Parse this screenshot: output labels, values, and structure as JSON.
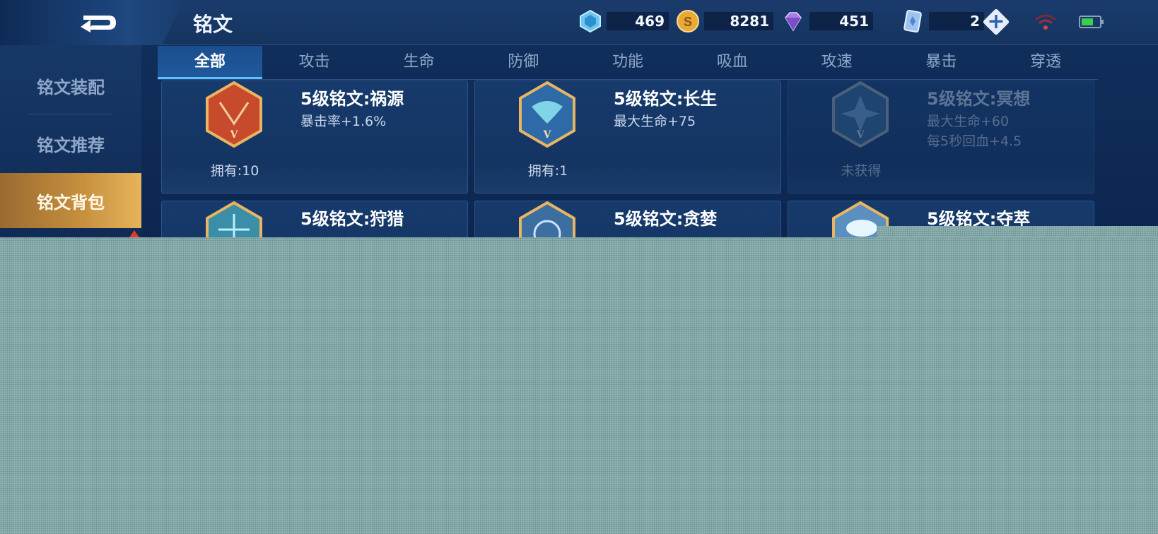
{
  "header": {
    "title": "铭文",
    "resources": [
      {
        "icon": "blue-crystal-icon",
        "value": "469"
      },
      {
        "icon": "gold-coin-icon",
        "value": "8281"
      },
      {
        "icon": "purple-diamond-icon",
        "value": "451"
      },
      {
        "icon": "card-ticket-icon",
        "value": "2"
      }
    ]
  },
  "sidebar": {
    "items": [
      {
        "label": "铭文装配"
      },
      {
        "label": "铭文推荐"
      },
      {
        "label": "铭文背包"
      }
    ]
  },
  "tabs": [
    "全部",
    "攻击",
    "生命",
    "防御",
    "功能",
    "吸血",
    "攻速",
    "暴击",
    "穿透"
  ],
  "cards": [
    {
      "name": "5级铭文:祸源",
      "stats": [
        "暴击率+1.6%"
      ],
      "owned": "拥有:10",
      "color": "#c84a2c"
    },
    {
      "name": "5级铭文:长生",
      "stats": [
        "最大生命+75"
      ],
      "owned": "拥有:1",
      "color": "#2e6aa8"
    },
    {
      "name": "5级铭文:冥想",
      "stats": [
        "最大生命+60",
        "每5秒回血+4.5"
      ],
      "owned": "未获得",
      "color": "#2c5a86"
    },
    {
      "name": "5级铭文:狩猎",
      "stats": [],
      "owned": "",
      "color": "#3b8ea8"
    },
    {
      "name": "5级铭文:贪婪",
      "stats": [],
      "owned": "",
      "color": "#3c6ea0"
    },
    {
      "name": "5级铭文:夺萃",
      "stats": [],
      "owned": "",
      "color": "#5a8fc0"
    }
  ],
  "colors": {
    "accent_gold": "#c8913f",
    "tab_active": "#5fc0ff",
    "battery": "#3ccf4e",
    "wifi": "#d64545"
  }
}
